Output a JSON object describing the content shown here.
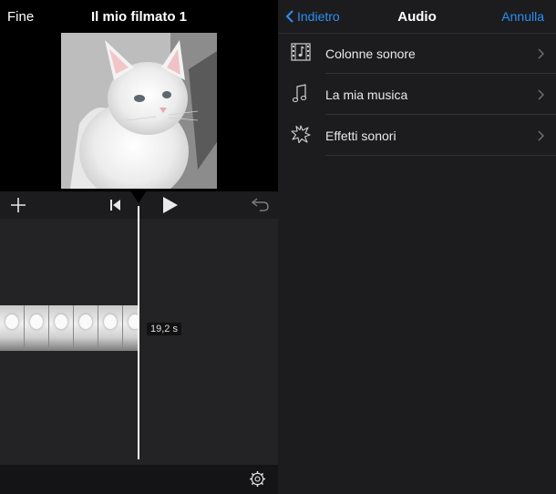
{
  "editor": {
    "done_label": "Fine",
    "project_title": "Il mio filmato 1",
    "duration_label": "19,2 s",
    "toolbar_icons": [
      "plus-icon",
      "skip-to-start-icon",
      "play-icon",
      "undo-icon"
    ],
    "bottom_icons": [
      "settings-gear-icon"
    ],
    "preview_subject": "cat"
  },
  "audio_panel": {
    "back_label": "Indietro",
    "title": "Audio",
    "cancel_label": "Annulla",
    "items": [
      {
        "label": "Colonne sonore",
        "icon": "film-note-icon"
      },
      {
        "label": "La mia musica",
        "icon": "music-note-icon"
      },
      {
        "label": "Effetti sonori",
        "icon": "burst-icon"
      }
    ]
  },
  "colors": {
    "accent": "#2d8ef5",
    "panel_bg": "#1c1c1e",
    "timeline_bg": "#232325"
  }
}
